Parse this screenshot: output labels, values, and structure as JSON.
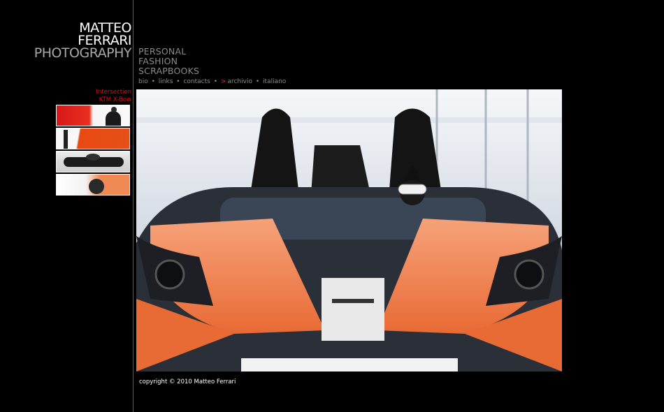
{
  "logo": {
    "line1": "MATTEO",
    "line2": "FERRARI",
    "line3": "PHOTOGRAPHY"
  },
  "menu": {
    "items": [
      "PERSONAL",
      "FASHION",
      "SCRAPBOOKS"
    ]
  },
  "submenu": {
    "items": [
      "bio",
      "links",
      "contacts",
      "archivio",
      "italiano"
    ],
    "separator": "•",
    "arrow": ">"
  },
  "gallery": {
    "title_line1": "Intersection",
    "title_line2": "KTM X-Bow"
  },
  "footer": {
    "copyright": "copyright © 2010 Matteo Ferrari"
  },
  "colors": {
    "accent": "#e01010",
    "car_orange": "#f08a55",
    "menu_gray": "#8a8a8a"
  }
}
